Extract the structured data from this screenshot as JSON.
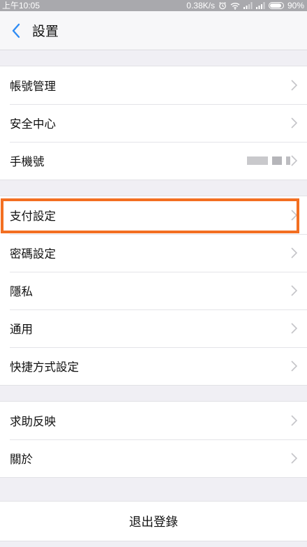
{
  "status_bar": {
    "time": "上午10:05",
    "network_speed": "0.38K/s",
    "battery": "90%",
    "battery_level": 0.9,
    "icons": [
      "alarm-icon",
      "wifi-icon",
      "signal-icon",
      "signal-icon",
      "battery-icon"
    ]
  },
  "nav": {
    "back_icon": "chevron-left-icon",
    "title": "設置"
  },
  "groups": [
    {
      "items": [
        {
          "label": "帳號管理"
        },
        {
          "label": "安全中心"
        },
        {
          "label": "手機號"
        }
      ]
    },
    {
      "items": [
        {
          "label": "支付設定"
        },
        {
          "label": "密碼設定"
        },
        {
          "label": "隱私"
        },
        {
          "label": "通用"
        },
        {
          "label": "快捷方式設定"
        }
      ]
    },
    {
      "items": [
        {
          "label": "求助反映"
        },
        {
          "label": "關於"
        }
      ]
    }
  ],
  "logout": {
    "label": "退出登錄"
  },
  "colors": {
    "accent": "#2f8cf4",
    "highlight": "#f36f21",
    "background": "#f0eff4",
    "chevron": "#c4c4c8"
  }
}
